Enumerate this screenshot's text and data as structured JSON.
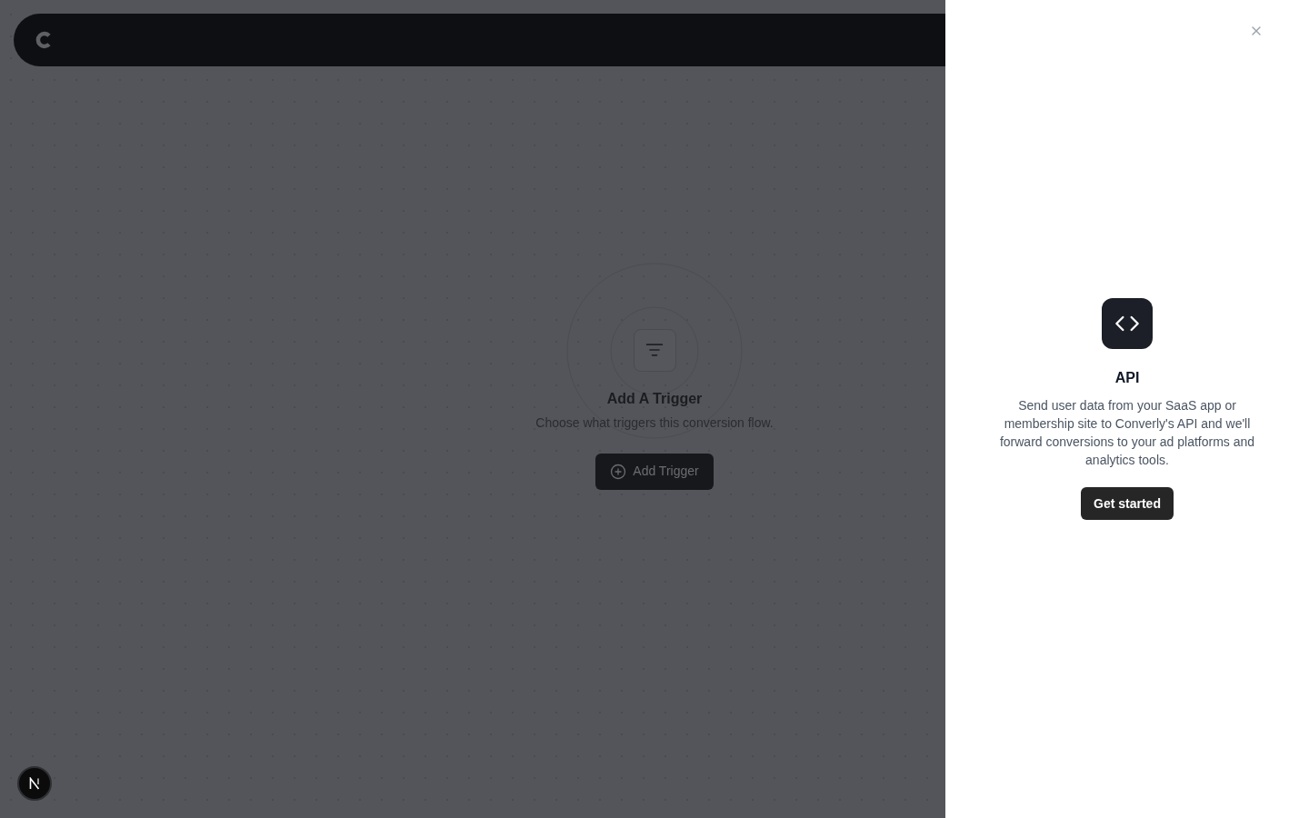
{
  "canvas": {
    "empty_state": {
      "title": "Add A Trigger",
      "description": "Choose what triggers this conversion flow.",
      "button": "Add Trigger"
    }
  },
  "panel": {
    "title": "API",
    "description": "Send user data from your SaaS app or membership site to Converly's API and we'll forward conversions to your ad platforms and analytics tools.",
    "button": "Get started"
  }
}
